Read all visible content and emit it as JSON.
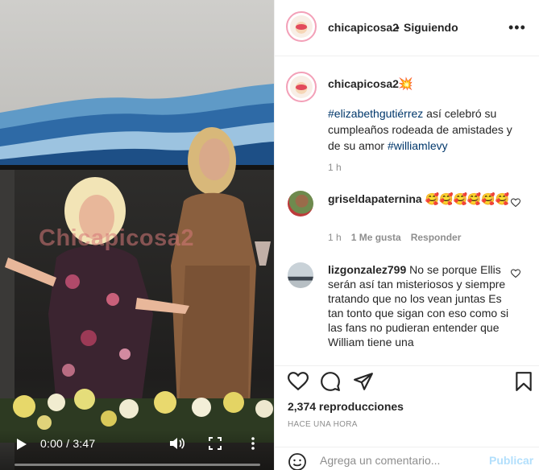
{
  "video": {
    "watermark": "Chicapicosa2",
    "time": "0:00 / 3:47",
    "progress": 0
  },
  "header": {
    "username": "chicapicosa2",
    "separator": "•",
    "follow_label": "Siguiendo",
    "options_icon": "more-horizontal-icon"
  },
  "caption": {
    "username": "chicapicosa2",
    "emoji": "💥",
    "hashtag1": "#elizabethgutiérrez",
    "text1": " así celebró su cumpleaños rodeada de amistades y de su amor ",
    "hashtag2": "#williamlevy",
    "time": "1 h"
  },
  "comments": [
    {
      "username": "griseldapaternina",
      "text": " 🥰🥰🥰🥰🥰🥰",
      "time": "1 h",
      "likes": "1 Me gusta",
      "reply": "Responder"
    },
    {
      "username": "lizgonzalez799",
      "text": " No se porque Ellis serán así tan misteriosos y siempre tratando que no los vean juntas Es tan tonto que sigan con eso como si las fans no pudieran entender que William tiene una"
    }
  ],
  "actions": {
    "views": "2,374 reproducciones",
    "posted": "HACE UNA HORA"
  },
  "add_comment": {
    "placeholder": "Agrega un comentario...",
    "post_label": "Publicar"
  },
  "colors": {
    "link": "#00376b",
    "muted": "#8e8e8e",
    "post_disabled": "#b2dffc",
    "text": "#262626"
  }
}
